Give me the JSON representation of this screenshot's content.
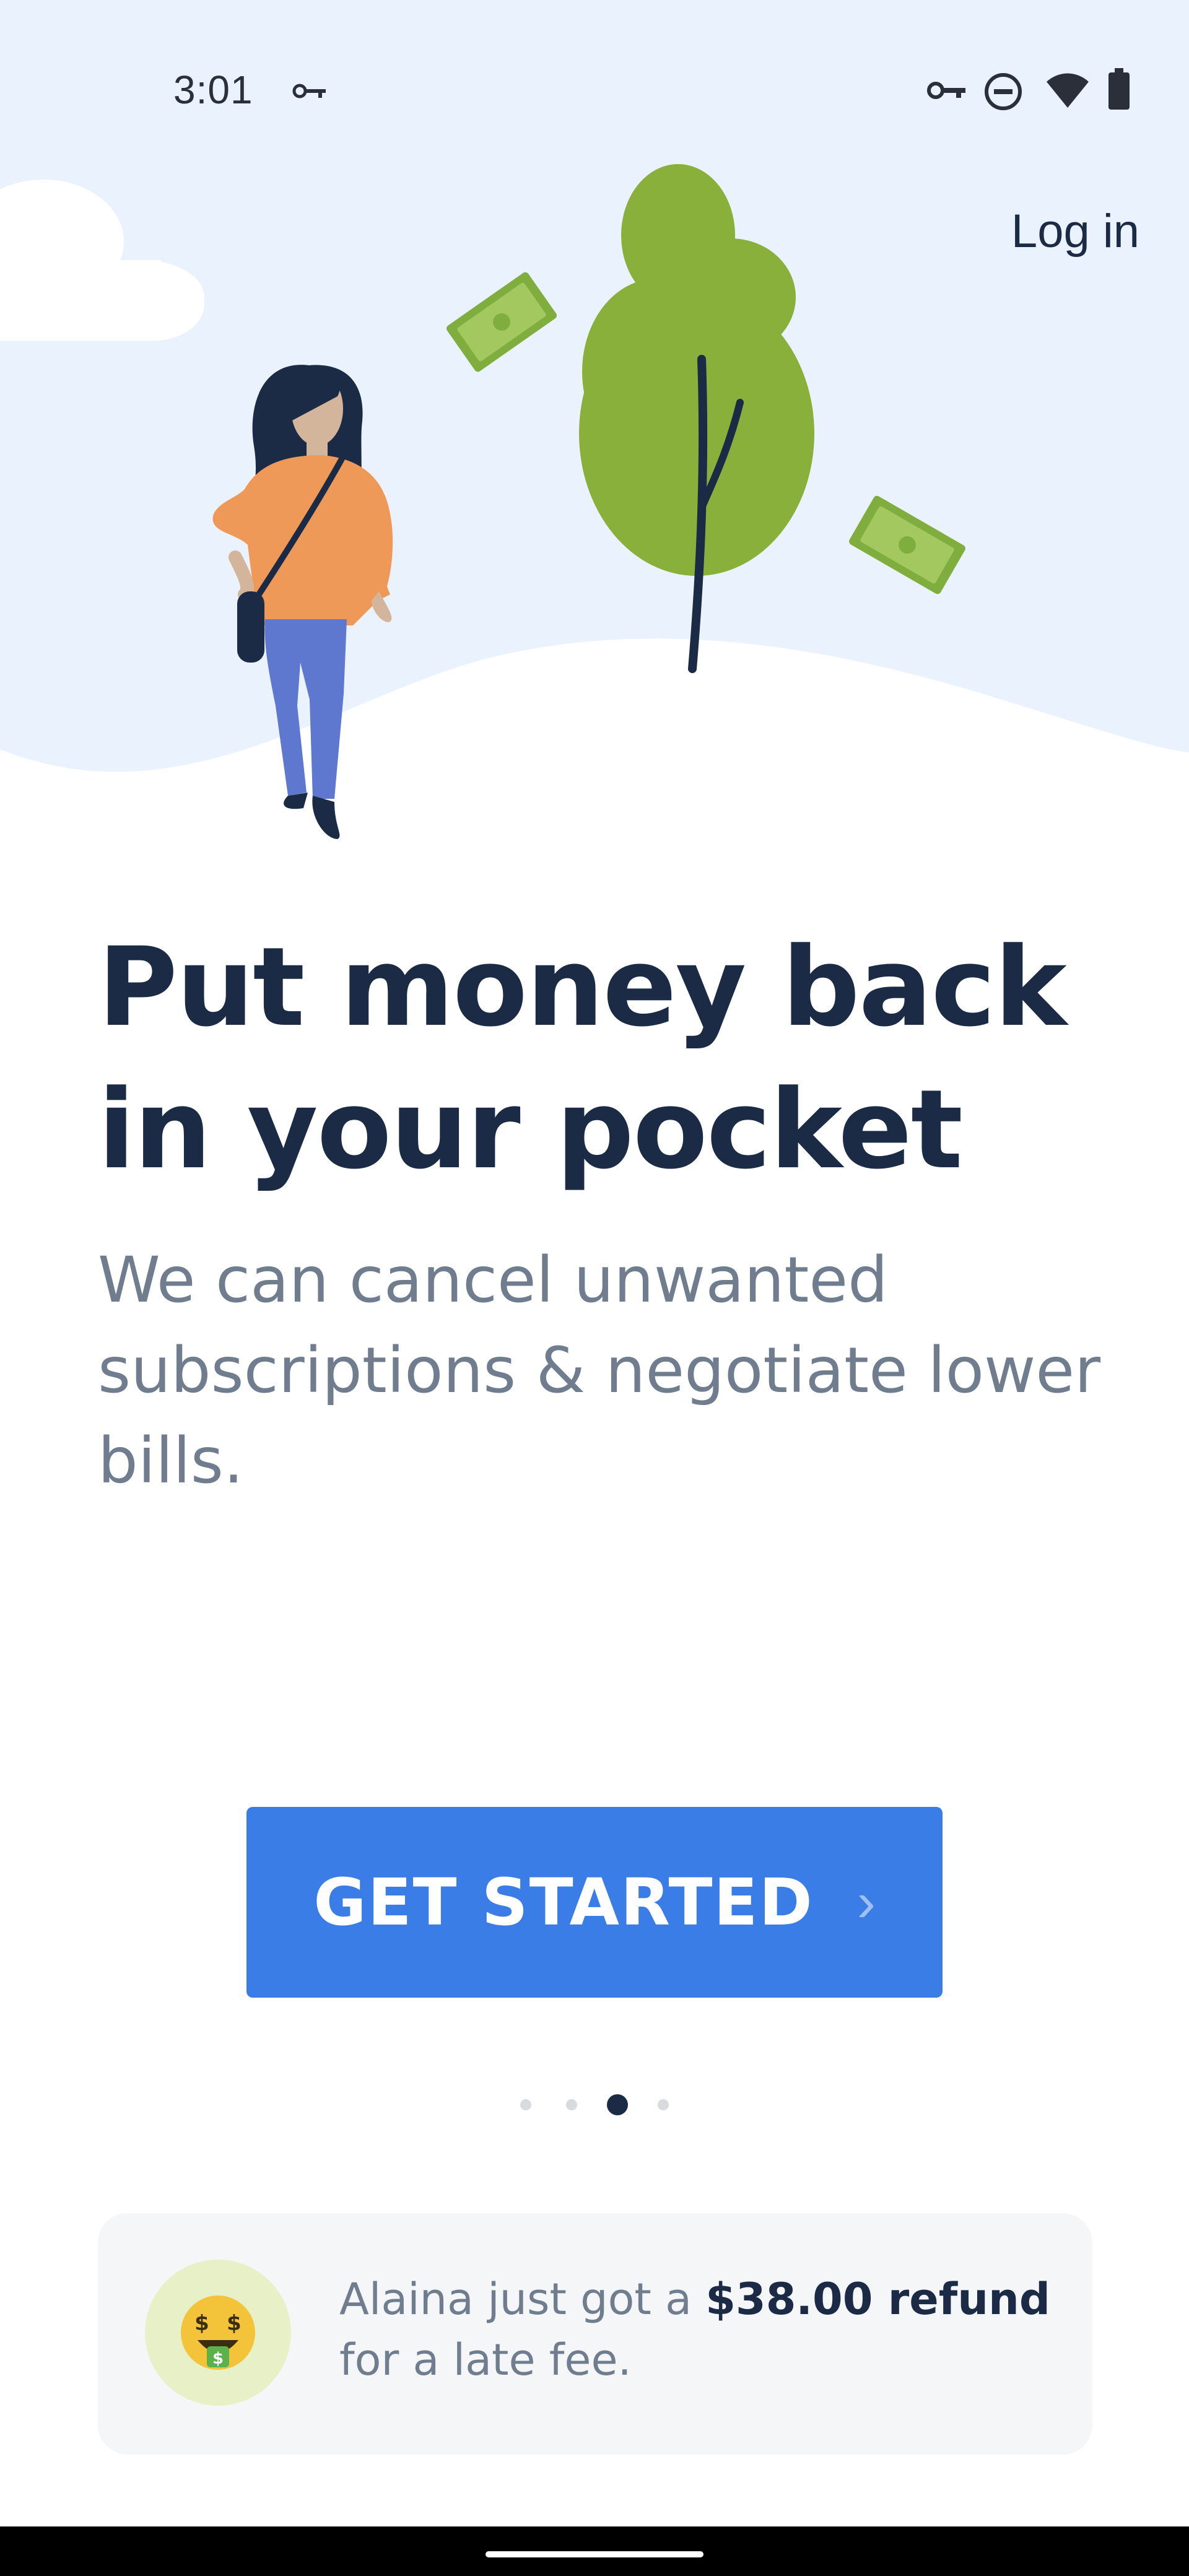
{
  "status_bar": {
    "time": "3:01",
    "icons": [
      "vpn-key-icon",
      "vpn-key-icon",
      "do-not-disturb-icon",
      "wifi-icon",
      "battery-icon"
    ]
  },
  "header": {
    "login_label": "Log in"
  },
  "hero": {
    "illustration": "woman walking beside tree with flying money bills"
  },
  "main": {
    "headline": "Put money back in your pocket",
    "subtitle": "We can cancel unwanted subscriptions & negotiate lower bills."
  },
  "cta": {
    "label": "GET STARTED",
    "chevron": "›"
  },
  "pager": {
    "count": 4,
    "active_index": 2
  },
  "notification": {
    "prefix": "Alaina just got a ",
    "amount": "$38.00 refund",
    "suffix": " for a late fee.",
    "emoji": "money-mouth-face-icon"
  },
  "colors": {
    "primary": "#3b7de6",
    "heading": "#1c2b45",
    "body_text": "#6f7d8e",
    "hero_bg": "#eaf3fd"
  }
}
